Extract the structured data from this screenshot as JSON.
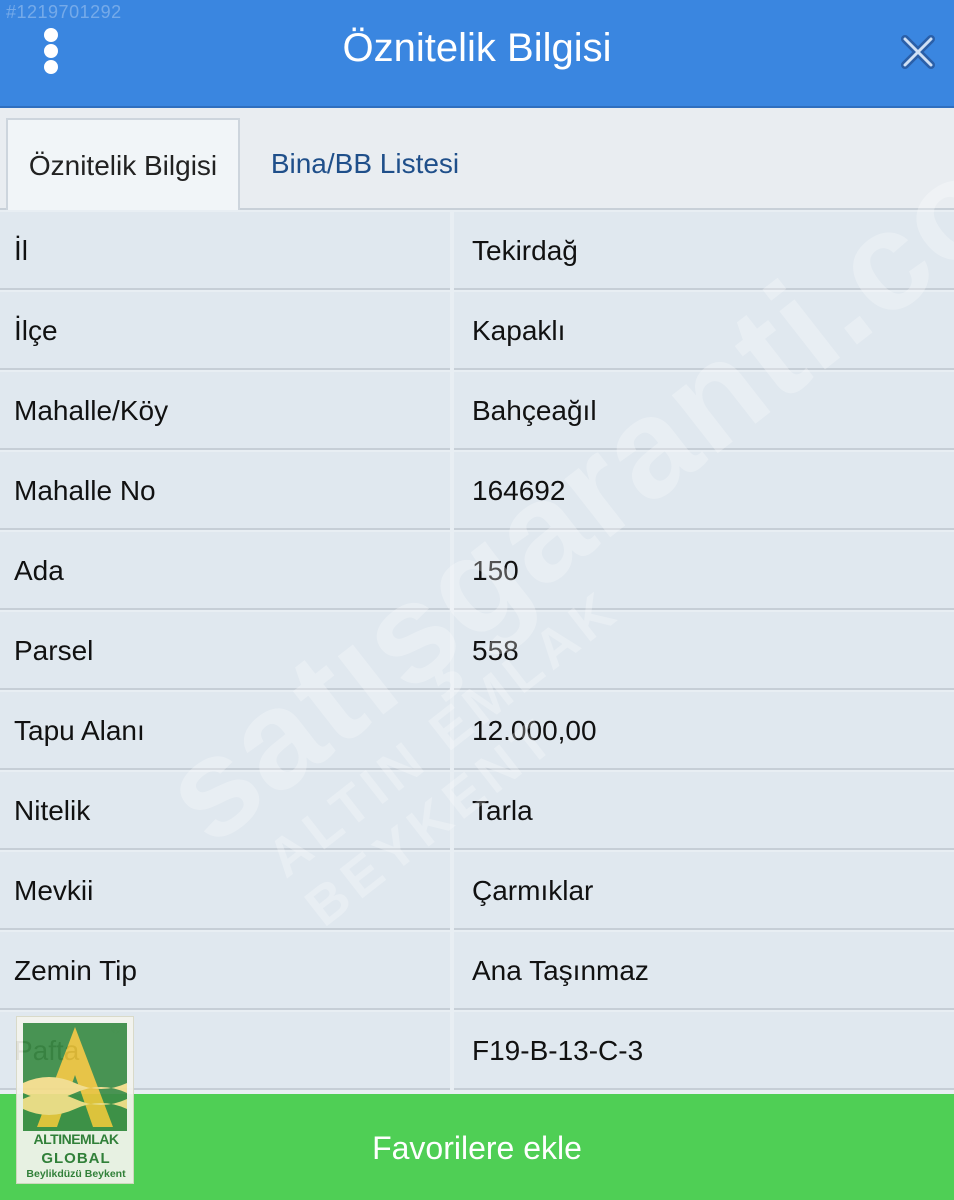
{
  "header": {
    "ref_id": "#1219701292",
    "title": "Öznitelik Bilgisi"
  },
  "tabs": [
    {
      "label": "Öznitelik Bilgisi",
      "active": true
    },
    {
      "label": "Bina/BB Listesi",
      "active": false
    }
  ],
  "attributes": [
    {
      "key": "İl",
      "value": "Tekirdağ"
    },
    {
      "key": "İlçe",
      "value": "Kapaklı"
    },
    {
      "key": "Mahalle/Köy",
      "value": "Bahçeağıl"
    },
    {
      "key": "Mahalle No",
      "value": "164692"
    },
    {
      "key": "Ada",
      "value": "150"
    },
    {
      "key": "Parsel",
      "value": "558"
    },
    {
      "key": "Tapu Alanı",
      "value": "12.000,00"
    },
    {
      "key": "Nitelik",
      "value": "Tarla"
    },
    {
      "key": "Mevkii",
      "value": "Çarmıklar"
    },
    {
      "key": "Zemin Tip",
      "value": "Ana Taşınmaz"
    },
    {
      "key": "Pafta",
      "value": "F19-B-13-C-3"
    }
  ],
  "favorites_button": "Favorilere ekle",
  "watermark": {
    "main": "satışgaranti.com",
    "sub": "ALTIN EMLAK BEYKENT"
  },
  "logo": {
    "brand": "ALTINEMLAK",
    "global": "GLOBAL",
    "branch": "Beylikdüzü Beykent",
    "registered": "®"
  },
  "icons": {
    "menu": "kebab-menu-icon",
    "close": "close-x-icon"
  },
  "colors": {
    "header": "#3a86e0",
    "favorites": "#4fcf55",
    "row_bg": "#e0e8ef",
    "tab_link": "#1f4f8a"
  }
}
